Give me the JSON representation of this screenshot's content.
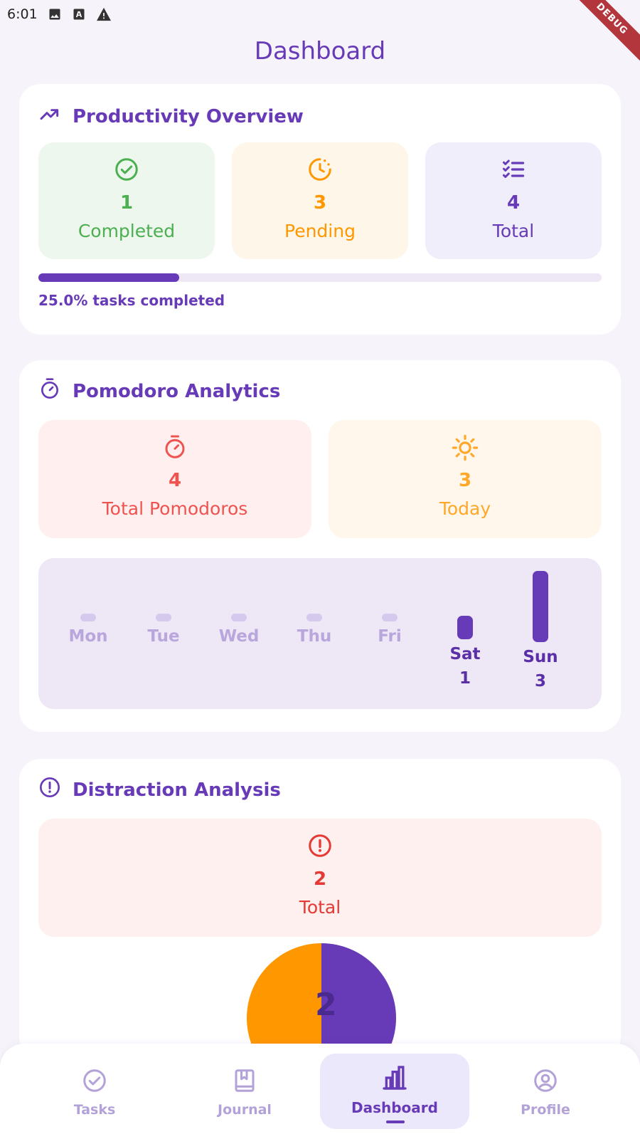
{
  "status_bar": {
    "time": "6:01"
  },
  "debug_label": "DEBUG",
  "app_title": "Dashboard",
  "productivity": {
    "title": "Productivity Overview",
    "stats": [
      {
        "value": "1",
        "label": "Completed",
        "color": "#4caf50",
        "bg": "#eef7ee",
        "icon": "check-circle-icon"
      },
      {
        "value": "3",
        "label": "Pending",
        "color": "#ff9800",
        "bg": "#fff6ea",
        "icon": "clock-icon"
      },
      {
        "value": "4",
        "label": "Total",
        "color": "#673ab7",
        "bg": "#f1eefb",
        "icon": "checklist-icon"
      }
    ],
    "progress_percent": 25.0,
    "progress_text": "25.0% tasks completed"
  },
  "pomodoro": {
    "title": "Pomodoro Analytics",
    "stats": [
      {
        "value": "4",
        "label": "Total Pomodoros",
        "color": "#ef5350",
        "bg": "#fff0ef",
        "icon": "timer-icon"
      },
      {
        "value": "3",
        "label": "Today",
        "color": "#ffa726",
        "bg": "#fff7ec",
        "icon": "sun-icon"
      }
    ],
    "week": [
      {
        "day": "Mon",
        "count": 0,
        "count_label": ""
      },
      {
        "day": "Tue",
        "count": 0,
        "count_label": ""
      },
      {
        "day": "Wed",
        "count": 0,
        "count_label": ""
      },
      {
        "day": "Thu",
        "count": 0,
        "count_label": ""
      },
      {
        "day": "Fri",
        "count": 0,
        "count_label": ""
      },
      {
        "day": "Sat",
        "count": 1,
        "count_label": "1"
      },
      {
        "day": "Sun",
        "count": 3,
        "count_label": "3"
      }
    ]
  },
  "distraction": {
    "title": "Distraction Analysis",
    "stat": {
      "value": "2",
      "label": "Total",
      "color": "#e53935",
      "bg": "#fdf0ee",
      "icon": "error-icon"
    },
    "pie_center": "2",
    "chart_data": {
      "type": "pie",
      "series": [
        {
          "values": [
            1,
            1
          ]
        }
      ],
      "colors": [
        "#ff9800",
        "#673ab7"
      ]
    }
  },
  "bottom_nav": [
    {
      "label": "Tasks",
      "icon": "check-circle-icon",
      "active": false
    },
    {
      "label": "Journal",
      "icon": "journal-icon",
      "active": false
    },
    {
      "label": "Dashboard",
      "icon": "bar-chart-icon",
      "active": true
    },
    {
      "label": "Profile",
      "icon": "profile-icon",
      "active": false
    }
  ]
}
